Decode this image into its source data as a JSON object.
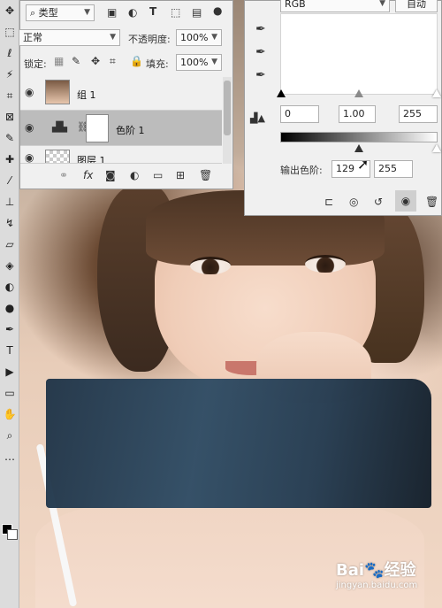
{
  "layers_panel": {
    "filter_kind": "类型",
    "blend_mode": "正常",
    "opacity_label": "不透明度:",
    "opacity_value": "100%",
    "lock_label": "锁定:",
    "fill_label": "填充:",
    "fill_value": "100%",
    "layers": [
      {
        "name": "组 1",
        "type": "group"
      },
      {
        "name": "色阶 1",
        "type": "adjustment",
        "selected": true
      },
      {
        "name": "图层 1",
        "type": "pixel"
      }
    ],
    "footer_icons": [
      "link-icon",
      "fx-icon",
      "mask-icon",
      "adjustment-icon",
      "folder-icon",
      "new-layer-icon",
      "trash-icon"
    ]
  },
  "properties_panel": {
    "channel": "RGB",
    "auto_button": "自动",
    "input_black": "0",
    "input_gamma": "1.00",
    "input_white": "255",
    "output_label": "输出色阶:",
    "output_black": "129",
    "output_white": "255",
    "footer_icons": [
      "clip-icon",
      "view-prev-icon",
      "reset-icon",
      "visibility-icon",
      "trash-icon"
    ]
  },
  "watermark": {
    "brand": "Bai",
    "paw": "🐾",
    "brand2": "经验",
    "url": "jingyan.baidu.com"
  }
}
